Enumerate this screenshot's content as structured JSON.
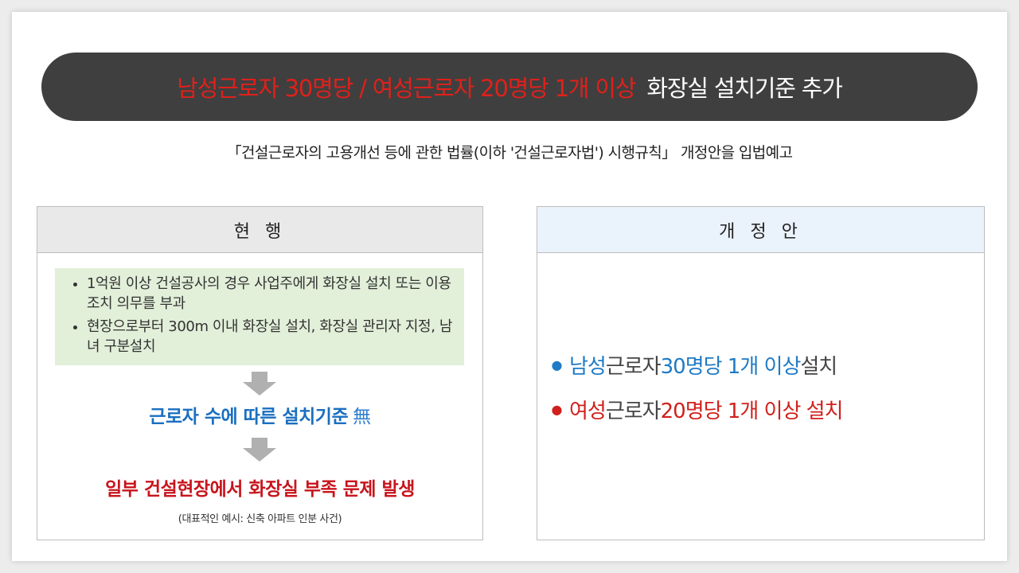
{
  "title": {
    "highlight": "남성근로자 30명당 / 여성근로자 20명당 1개 이상",
    "rest": "화장실 설치기준 추가"
  },
  "subtitle": "「건설근로자의 고용개선 등에 관한 법률(이하 '건설근로자법') 시행규칙」 개정안을 입법예고",
  "current": {
    "header": "현 행",
    "bullets": [
      "1억원 이상 건설공사의 경우 사업주에게 화장실 설치 또는 이용 조치 의무를 부과",
      "현장으로부터 300m 이내 화장실 설치, 화장실 관리자 지정, 남녀 구분설치"
    ],
    "consequence": "근로자 수에 따른 설치기준",
    "consequence_mark": "無",
    "result": "일부 건설현장에서 화장실 부족 문제 발생",
    "note": "(대표적인 예시: 신축 아파트 인분 사건)"
  },
  "proposal": {
    "header": "개 정 안",
    "items": [
      {
        "a": "남성",
        "b": " 근로자 ",
        "c": "30명당 1개 이상",
        "d": " 설치"
      },
      {
        "a": "여성",
        "b": " 근로자 ",
        "c": "20명당 1개 이상 설치",
        "d": ""
      }
    ]
  },
  "colors": {
    "pill_bg": "#3f3f3f",
    "title_red": "#e0201b",
    "blue": "#1a6fc0",
    "red": "#c8141c",
    "green_bg": "#e2efd9",
    "proposal_head_bg": "#eaf2fb"
  }
}
